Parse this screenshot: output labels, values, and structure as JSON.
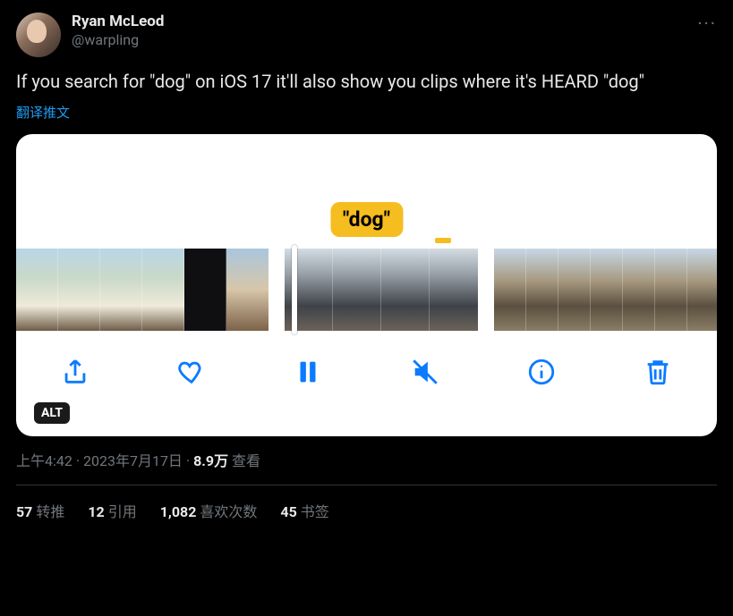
{
  "author": {
    "display_name": "Ryan McLeod",
    "handle": "@warpling"
  },
  "more_glyph": "···",
  "tweet_text": "If you search for \"dog\" on iOS 17 it'll also show you clips where it's HEARD \"dog\"",
  "translate_label": "翻译推文",
  "media": {
    "chip_label": "\"dog\"",
    "alt_badge": "ALT",
    "toolbar": {
      "share": "share",
      "like": "like",
      "pause": "pause",
      "mute": "mute",
      "info": "info",
      "delete": "delete"
    }
  },
  "meta": {
    "time": "上午4:42",
    "dot1": " · ",
    "date": "2023年7月17日",
    "dot2": " · ",
    "views_num": "8.9万",
    "views_label": " 查看"
  },
  "stats": {
    "retweets_num": "57",
    "retweets_label": "转推",
    "quotes_num": "12",
    "quotes_label": "引用",
    "likes_num": "1,082",
    "likes_label": "喜欢次数",
    "bookmarks_num": "45",
    "bookmarks_label": "书签"
  }
}
